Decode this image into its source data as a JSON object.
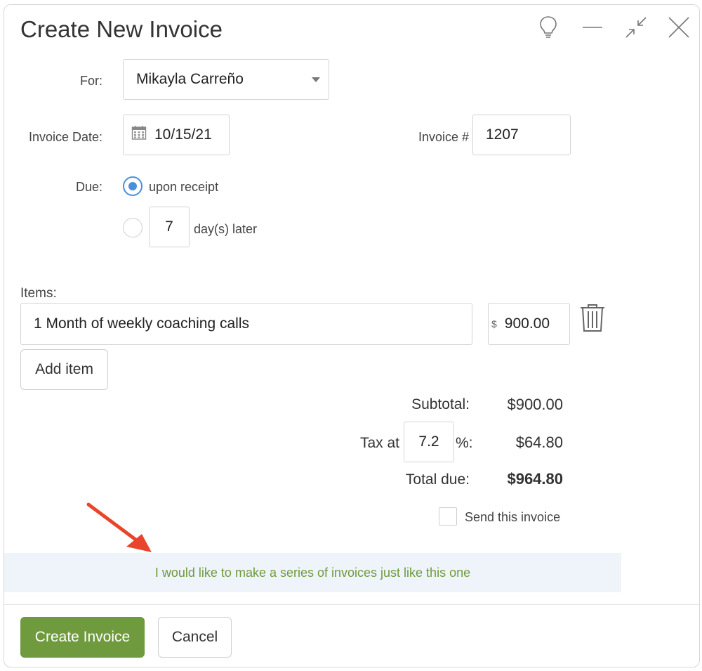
{
  "dialog": {
    "title": "Create New Invoice",
    "controls": {
      "hint": "lightbulb-icon",
      "minimize": "minimize-icon",
      "collapse": "collapse-icon",
      "close": "close-icon"
    }
  },
  "form": {
    "for_label": "For:",
    "for_value": "Mikayla Carreño",
    "invoice_date_label": "Invoice Date:",
    "invoice_date_value": "10/15/21",
    "invoice_number_label": "Invoice #",
    "invoice_number_value": "1207",
    "due_label": "Due:",
    "due_options": [
      {
        "label": "upon receipt",
        "selected": true
      },
      {
        "label": "day(s) later",
        "days": "7",
        "selected": false
      }
    ]
  },
  "items": {
    "label": "Items:",
    "rows": [
      {
        "description": "1 Month of weekly coaching calls",
        "currency": "$",
        "amount": "900.00"
      }
    ],
    "add_label": "Add item"
  },
  "summary": {
    "subtotal_label": "Subtotal:",
    "subtotal_value": "$900.00",
    "tax_label": "Tax at",
    "tax_rate": "7.2",
    "tax_suffix": "%:",
    "tax_value": "$64.80",
    "total_label": "Total due:",
    "total_value": "$964.80"
  },
  "send_label": "Send this invoice",
  "series_link": "I would like to make a series of invoices just like this one",
  "footer": {
    "create_label": "Create Invoice",
    "cancel_label": "Cancel"
  },
  "colors": {
    "accent": "#6f9a3d",
    "radio": "#4a90d9",
    "annotation_arrow": "#e8452c",
    "series_bg": "#eef4fa"
  }
}
